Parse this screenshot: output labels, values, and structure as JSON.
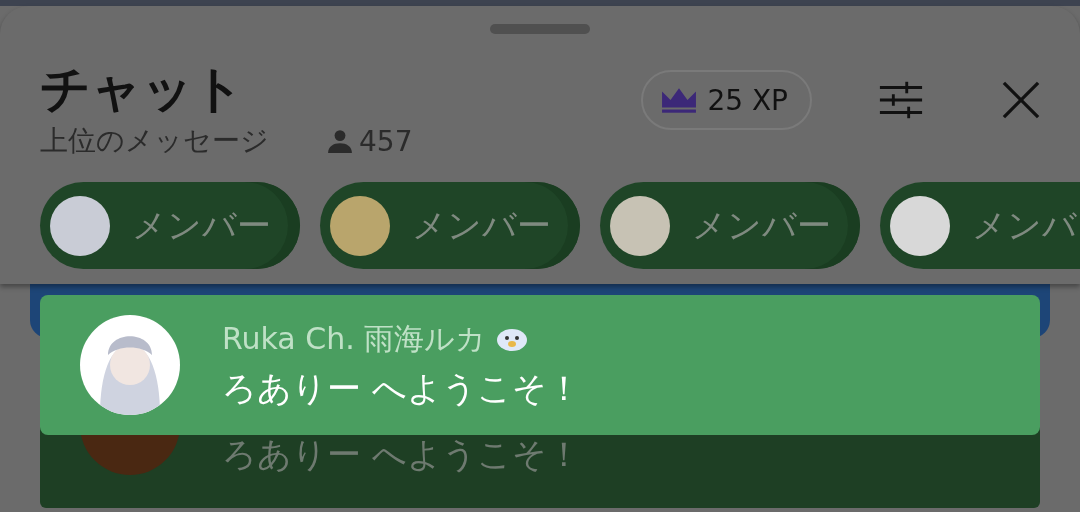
{
  "sheet": {
    "title": "チャット",
    "subtitle": "上位のメッセージ",
    "viewer_count": "457",
    "xp_badge": "25 XP"
  },
  "chips": [
    {
      "label": "メンバー"
    },
    {
      "label": "メンバー"
    },
    {
      "label": "メンバー"
    },
    {
      "label": "メンバ"
    }
  ],
  "toast": {
    "author": "Ruka Ch. 雨海ルカ",
    "message": "ろありー へようこそ！"
  },
  "background_message": {
    "message": "ろありー へようこそ！"
  }
}
